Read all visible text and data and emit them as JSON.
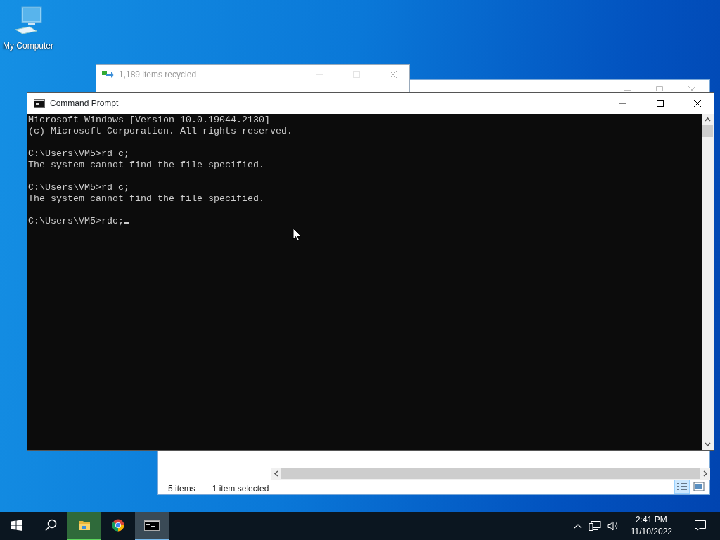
{
  "desktop_icons": [
    {
      "label": "My Computer",
      "selected": false
    }
  ],
  "explorer_window": {
    "status_items": [
      "5 items",
      "1 item selected"
    ],
    "views": [
      {
        "kind": "details",
        "selected": true
      },
      {
        "kind": "thumbnails",
        "selected": false
      }
    ]
  },
  "progress_dialog": {
    "title": "1,189 items recycled",
    "controls_disabled": true
  },
  "command_prompt": {
    "title": "Command Prompt",
    "blocks": [
      [
        "Microsoft Windows [Version 10.0.19044.2130]",
        "(c) Microsoft Corporation. All rights reserved."
      ],
      [
        "C:\\Users\\VM5>rd c;",
        "The system cannot find the file specified."
      ],
      [
        "C:\\Users\\VM5>rd c;",
        "The system cannot find the file specified."
      ],
      [
        "C:\\Users\\VM5>rdc;"
      ]
    ],
    "cursor_visible": true
  },
  "taskbar": {
    "items": [
      {
        "kind": "start",
        "selected": false,
        "attention": false
      },
      {
        "kind": "search",
        "selected": false,
        "attention": false
      },
      {
        "kind": "folder",
        "selected": false,
        "attention": true
      },
      {
        "kind": "browser",
        "selected": false,
        "attention": false
      },
      {
        "kind": "terminal",
        "selected": true,
        "attention": false
      }
    ],
    "tray": {
      "time": "2:41 PM",
      "date": "11/10/2022"
    }
  }
}
